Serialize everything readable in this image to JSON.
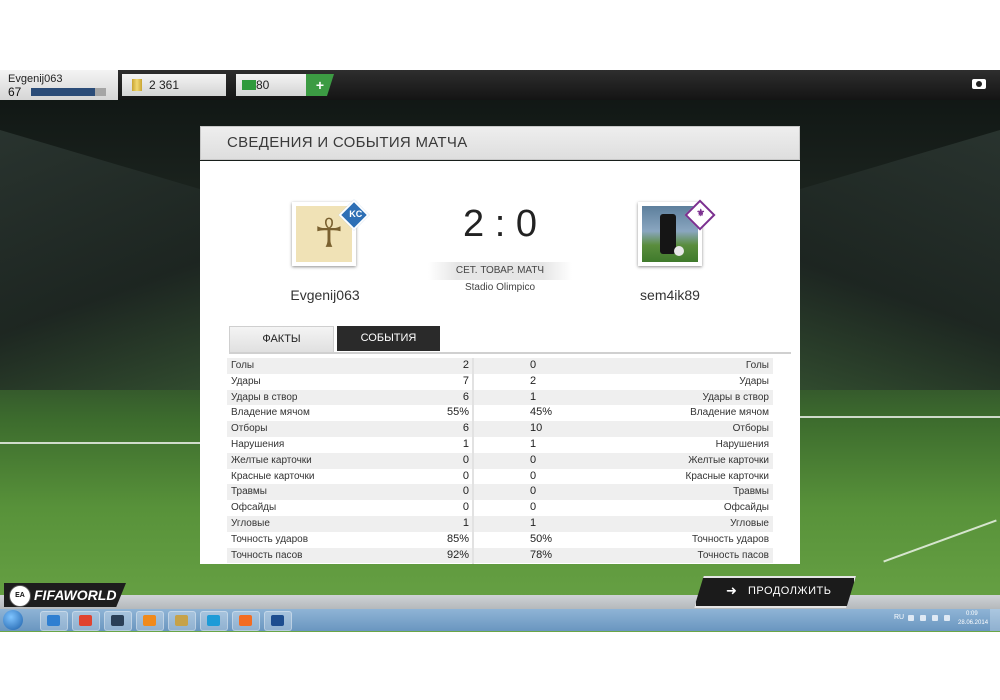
{
  "topbar": {
    "player_name": "Evgenij063",
    "player_level": "67",
    "xp_progress": 0.85,
    "coins": "2 361",
    "points": "80",
    "add_points_label": "+"
  },
  "panel": {
    "title": "СВЕДЕНИЯ И СОБЫТИЯ МАТЧА",
    "home_team": "Evgenij063",
    "away_team": "sem4ik89",
    "home_badge_text": "KC",
    "score": "2 : 0",
    "match_type": "СЕТ. ТОВАР. МАТЧ",
    "stadium": "Stadio Olimpico",
    "tabs": [
      {
        "label": "ФАКТЫ",
        "active": true
      },
      {
        "label": "СОБЫТИЯ",
        "active": false
      }
    ],
    "stats": [
      {
        "label": "Голы",
        "home": "2",
        "away": "0"
      },
      {
        "label": "Удары",
        "home": "7",
        "away": "2"
      },
      {
        "label": "Удары в створ",
        "home": "6",
        "away": "1"
      },
      {
        "label": "Владение мячом",
        "home": "55%",
        "away": "45%"
      },
      {
        "label": "Отборы",
        "home": "6",
        "away": "10"
      },
      {
        "label": "Нарушения",
        "home": "1",
        "away": "1"
      },
      {
        "label": "Желтые карточки",
        "home": "0",
        "away": "0"
      },
      {
        "label": "Красные карточки",
        "home": "0",
        "away": "0"
      },
      {
        "label": "Травмы",
        "home": "0",
        "away": "0"
      },
      {
        "label": "Офсайды",
        "home": "0",
        "away": "0"
      },
      {
        "label": "Угловые",
        "home": "1",
        "away": "1"
      },
      {
        "label": "Точность ударов",
        "home": "85%",
        "away": "50%"
      },
      {
        "label": "Точность пасов",
        "home": "92%",
        "away": "78%"
      }
    ]
  },
  "footer": {
    "brand_badge": "EA SPORTS",
    "brand": "FIFAWORLD",
    "continue_label": "ПРОДОЛЖИТЬ",
    "continue_arrow": "➜"
  },
  "taskbar": {
    "language": "RU",
    "time": "0:09",
    "date": "28.06.2014",
    "icons": [
      {
        "name": "ie-icon",
        "color": "#2f7fd1"
      },
      {
        "name": "chrome-icon",
        "color": "#e0432f"
      },
      {
        "name": "monitor-icon",
        "color": "#2a3f57"
      },
      {
        "name": "media-player-icon",
        "color": "#f08a1c"
      },
      {
        "name": "game-icon",
        "color": "#c6a24a"
      },
      {
        "name": "skype-icon",
        "color": "#1d9bd7"
      },
      {
        "name": "origin-icon",
        "color": "#f36c21"
      },
      {
        "name": "fifa-world-icon",
        "color": "#1d4d8f"
      }
    ]
  }
}
